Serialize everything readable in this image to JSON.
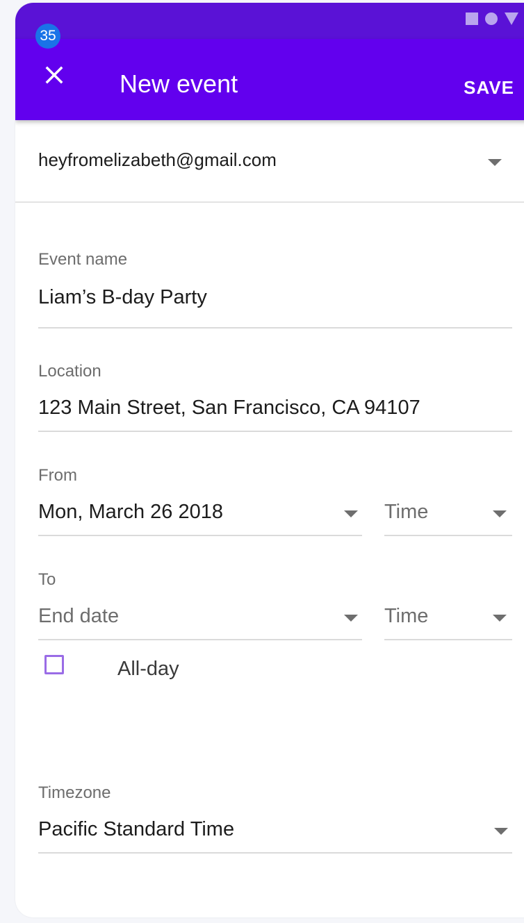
{
  "notification_badge": "35",
  "colors": {
    "status_bar": "#5a12d6",
    "app_bar": "#6200ee",
    "badge": "#1a73e8",
    "checkbox_border": "#9a6ce6"
  },
  "app_bar": {
    "close_icon": "close-icon",
    "title": "New event",
    "save_label": "SAVE"
  },
  "account": {
    "email": "heyfromelizabeth@gmail.com"
  },
  "form": {
    "event_name": {
      "label": "Event name",
      "value": "Liam’s B-day Party"
    },
    "location": {
      "label": "Location",
      "value": "123 Main Street, San Francisco, CA 94107"
    },
    "from": {
      "label": "From",
      "date": "Mon, March 26 2018",
      "time_placeholder": "Time"
    },
    "to": {
      "label": "To",
      "date_placeholder": "End date",
      "time_placeholder": "Time"
    },
    "all_day": {
      "label": "All-day",
      "checked": false
    },
    "timezone": {
      "label": "Timezone",
      "value": "Pacific Standard Time"
    }
  }
}
